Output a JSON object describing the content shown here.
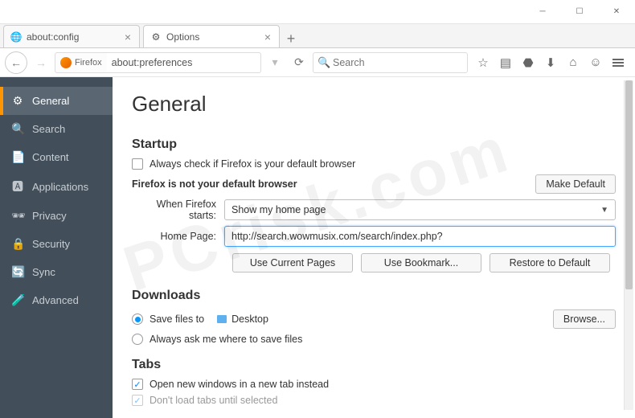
{
  "window": {
    "tabs": [
      {
        "label": "about:config",
        "active": false
      },
      {
        "label": "Options",
        "active": true
      }
    ]
  },
  "urlbar": {
    "identity": "Firefox",
    "url": "about:preferences",
    "search_placeholder": "Search"
  },
  "sidebar": {
    "items": [
      {
        "label": "General",
        "icon": "⚙",
        "name": "general"
      },
      {
        "label": "Search",
        "icon": "🔍",
        "name": "search"
      },
      {
        "label": "Content",
        "icon": "📄",
        "name": "content"
      },
      {
        "label": "Applications",
        "icon": "🅰",
        "name": "applications"
      },
      {
        "label": "Privacy",
        "icon": "🕶",
        "name": "privacy"
      },
      {
        "label": "Security",
        "icon": "🔒",
        "name": "security"
      },
      {
        "label": "Sync",
        "icon": "🔄",
        "name": "sync"
      },
      {
        "label": "Advanced",
        "icon": "🧪",
        "name": "advanced"
      }
    ],
    "selected": 0
  },
  "panel": {
    "title": "General",
    "startup": {
      "heading": "Startup",
      "always_check_label": "Always check if Firefox is your default browser",
      "default_status": "Firefox is not your default browser",
      "make_default_btn": "Make Default",
      "when_starts_label": "When Firefox starts:",
      "when_starts_value": "Show my home page",
      "homepage_label": "Home Page:",
      "homepage_value": "http://search.wowmusix.com/search/index.php?",
      "btn_current": "Use Current Pages",
      "btn_bookmark": "Use Bookmark...",
      "btn_restore": "Restore to Default"
    },
    "downloads": {
      "heading": "Downloads",
      "save_to_label": "Save files to",
      "save_location": "Desktop",
      "browse_btn": "Browse...",
      "ask_label": "Always ask me where to save files"
    },
    "tabs": {
      "heading": "Tabs",
      "open_new_label": "Open new windows in a new tab instead",
      "dont_load_label": "Don't load tabs until selected"
    }
  },
  "watermark": "PCrisk.com"
}
